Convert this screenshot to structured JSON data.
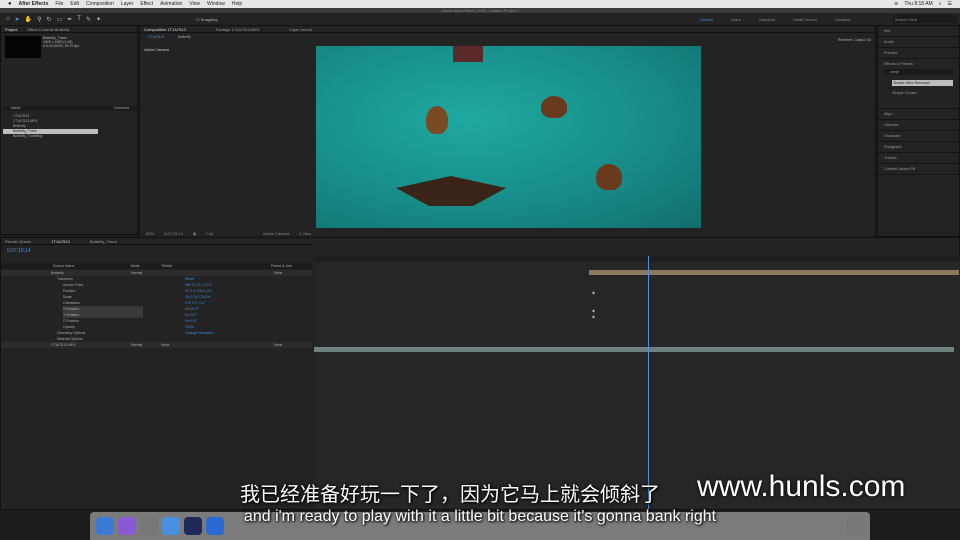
{
  "menubar": {
    "app": "After Effects",
    "items": [
      "File",
      "Edit",
      "Composition",
      "Layer",
      "Effect",
      "Animation",
      "View",
      "Window",
      "Help"
    ],
    "clock": "Thu 8:18 AM"
  },
  "window_title": "Adobe After Effects 2018 - Untitled Project *",
  "toolbar": {
    "snapping": "Snapping",
    "workspaces": [
      "Default",
      "Learn",
      "Standard",
      "Small Screen",
      "Libraries"
    ],
    "search_placeholder": "Search Help"
  },
  "project": {
    "tabs": [
      "Project",
      "Effect Controls Butterfly"
    ],
    "selected_name": "Butterfly_Trans",
    "info": [
      "1920 x 1080 (1.00)",
      "Δ 0;00;00;00, 29.97 fps"
    ],
    "col_name": "Name",
    "col_comment": "Comment",
    "items": [
      "1T1A7513",
      "1T1A7513.MP4",
      "Butterfly",
      "Butterfly_Trans",
      "Butterfly_Tumbling"
    ],
    "selected_index": 3
  },
  "viewer": {
    "tabs": [
      "Composition 1T1A7513",
      "Footage 1T1A7513.MP4",
      "Layer (none)"
    ],
    "breadcrumbs": [
      "1T1A7513",
      "Butterfly"
    ],
    "label": "Active Camera",
    "renderer": "Renderer: Classic 3D",
    "zoom": "50%",
    "timecode": "0;07;19;14",
    "resolution": "Full",
    "camera": "Active Camera",
    "views": "1 View"
  },
  "right_panel": {
    "items": [
      "Info",
      "Audio",
      "Preview",
      "Effects & Presets",
      "Align",
      "Libraries",
      "Character",
      "Paragraph",
      "Tracker",
      "Content-Aware Fill"
    ],
    "search_value": "simpl",
    "results": [
      "Simple Wire Removal",
      "Simple Choker"
    ]
  },
  "timeline": {
    "tabs": [
      "Render Queue",
      "1T1A7513",
      "Butterfly_Trans"
    ],
    "timecode": "0;07;19;14",
    "headers": [
      "Source Name",
      "Mode",
      "TrkMat",
      "Parent & Link"
    ],
    "layers": [
      {
        "name": "Butterfly",
        "mode": "Normal",
        "parent": "None",
        "value": ""
      },
      {
        "name": "Transform",
        "value": "Reset"
      },
      {
        "name": "Anchor Point",
        "value": "960.0,1717.0,0.0"
      },
      {
        "name": "Position",
        "value": "1171.6,708.0,-8.0"
      },
      {
        "name": "Scale",
        "value": "25.0,25.0,25.0%"
      },
      {
        "name": "Orientation",
        "value": "0.0°,0.0°,0.0°"
      },
      {
        "name": "X Rotation",
        "value": "0x+20.0°"
      },
      {
        "name": "Y Rotation",
        "value": "0x+0.0°"
      },
      {
        "name": "Z Rotation",
        "value": "0x+0.0°"
      },
      {
        "name": "Opacity",
        "value": "100%"
      },
      {
        "name": "Geometry Options",
        "value": "Change Renderer..."
      },
      {
        "name": "Material Options",
        "value": ""
      },
      {
        "name": "1T1A7513.MP4",
        "mode": "Normal",
        "trkmat": "None",
        "parent": "None",
        "value": ""
      }
    ]
  },
  "subtitles": {
    "zh": "我已经准备好玩一下了，因为它马上就会倾斜了",
    "en": "and i'm ready to play with it a little bit because it's gonna bank right"
  },
  "watermark": "www.hunls.com"
}
